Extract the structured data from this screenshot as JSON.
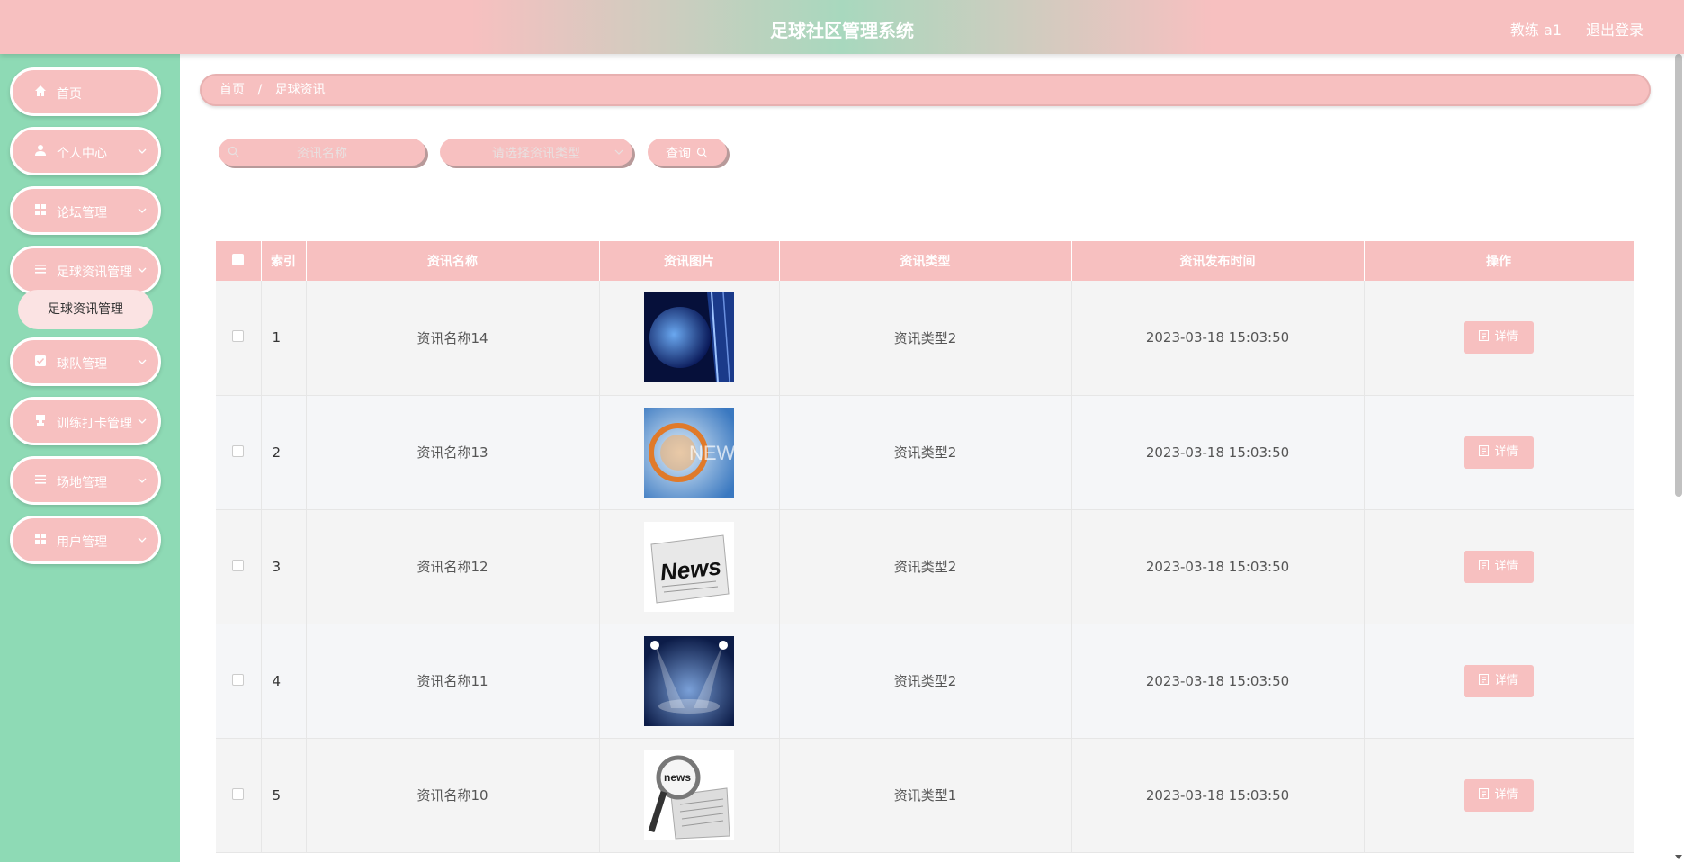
{
  "header": {
    "title": "足球社区管理系统",
    "user": "教练 a1",
    "logout": "退出登录"
  },
  "sidebar": {
    "items": [
      {
        "label": "首页",
        "icon": "home-icon"
      },
      {
        "label": "个人中心",
        "icon": "user-icon"
      },
      {
        "label": "论坛管理",
        "icon": "grid-icon"
      },
      {
        "label": "足球资讯管理",
        "icon": "list-icon"
      },
      {
        "label": "球队管理",
        "icon": "check-square-icon"
      },
      {
        "label": "训练打卡管理",
        "icon": "stamp-icon"
      },
      {
        "label": "场地管理",
        "icon": "list-icon"
      },
      {
        "label": "用户管理",
        "icon": "grid-icon"
      }
    ],
    "submenu_label": "足球资讯管理"
  },
  "breadcrumb": {
    "home": "首页",
    "sep": "/",
    "current": "足球资讯"
  },
  "search": {
    "name_placeholder": "资讯名称",
    "type_placeholder": "请选择资讯类型",
    "query_label": "查询"
  },
  "table": {
    "headers": [
      "索引",
      "资讯名称",
      "资讯图片",
      "资讯类型",
      "资讯发布时间",
      "操作"
    ],
    "detail_label": "详情",
    "rows": [
      {
        "index": "1",
        "name": "资讯名称14",
        "type": "资讯类型2",
        "time": "2023-03-18 15:03:50",
        "image": "globe-news"
      },
      {
        "index": "2",
        "name": "资讯名称13",
        "type": "资讯类型2",
        "time": "2023-03-18 15:03:50",
        "image": "news-blue"
      },
      {
        "index": "3",
        "name": "资讯名称12",
        "type": "资讯类型2",
        "time": "2023-03-18 15:03:50",
        "image": "news-paper"
      },
      {
        "index": "4",
        "name": "资讯名称11",
        "type": "资讯类型2",
        "time": "2023-03-18 15:03:50",
        "image": "stage-spotlight"
      },
      {
        "index": "5",
        "name": "资讯名称10",
        "type": "资讯类型1",
        "time": "2023-03-18 15:03:50",
        "image": "magnifier-news"
      }
    ]
  },
  "colors": {
    "pink": "#f7c0c0",
    "green": "#8edab5"
  }
}
